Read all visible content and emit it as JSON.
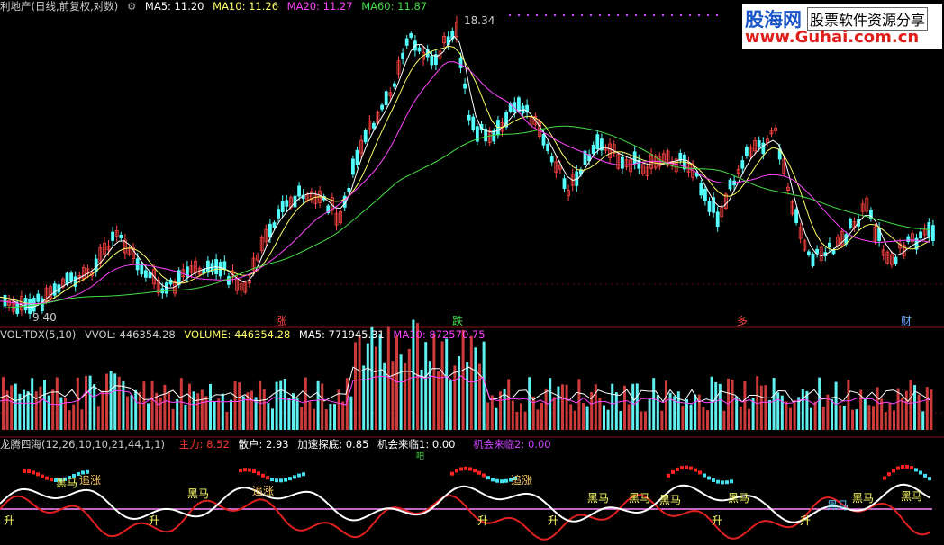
{
  "price_panel": {
    "title": "利地产(日线,前复权,对数)",
    "indicators": [
      {
        "name": "MA5",
        "value": "MA5: 11.20",
        "color": "#ffffff"
      },
      {
        "name": "MA10",
        "value": "MA10: 11.26",
        "color": "#ffff66"
      },
      {
        "name": "MA20",
        "value": "MA20: 11.27",
        "color": "#ff44ff"
      },
      {
        "name": "MA60",
        "value": "MA60: 11.87",
        "color": "#44dd44"
      }
    ],
    "high_label": "18.34",
    "low_label": "9.40",
    "event_marks": [
      "涨",
      "跌",
      "多",
      "财"
    ]
  },
  "volume_panel": {
    "title": "VOL-TDX(5,10)",
    "vvol": "VVOL: 446354.28",
    "volume": "VOLUME: 446354.28",
    "ma5": "MA5: 771945.31",
    "ma10": "MA10: 872570.75"
  },
  "indicator_panel": {
    "title": "龙腾四海(12,26,10,10,21,44,1,1)",
    "zhuli": "主力: 8.52",
    "sanhu": "散户: 2.93",
    "jiasu": "加速探底: 0.85",
    "jihui1": "机会来临1: 0.00",
    "jihui2": "机会来临2: 0.00",
    "signals": [
      "黑马",
      "追涨",
      "黑马",
      "追涨",
      "追涨",
      "黑马",
      "黑马",
      "黑马",
      "黑马",
      "黑马",
      "黑马",
      "黑马",
      "升",
      "升",
      "升",
      "升",
      "升",
      "升",
      "吧"
    ]
  },
  "watermark": {
    "brand": "股海网",
    "tagline": "股票软件资源分享",
    "url": "www.Guhai.com.cn"
  },
  "colors": {
    "up": "#ff4444",
    "down": "#54ffff",
    "ma5": "#ffffff",
    "ma10": "#ffff66",
    "ma20": "#ff44ff",
    "ma60": "#44dd44"
  }
}
